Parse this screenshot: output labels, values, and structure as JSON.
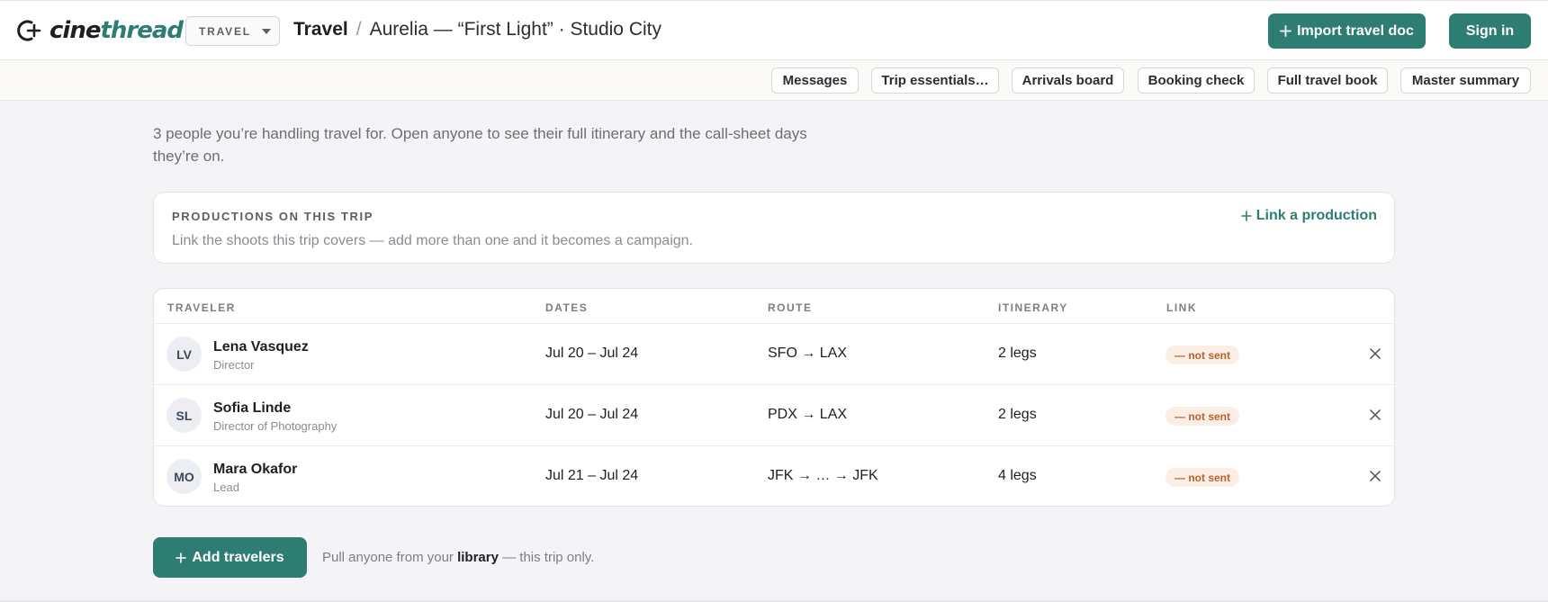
{
  "brand": {
    "logo_text_part1": "cine",
    "logo_text_part2": "thread",
    "accent_color": "#2e7d72"
  },
  "header": {
    "module": "TRAVEL",
    "breadcrumb_root": "Travel",
    "breadcrumb_separator": "/",
    "breadcrumb_current": "Aurelia — “First Light” · Studio City",
    "import_button": "Import travel doc",
    "signin_button": "Sign in"
  },
  "subnav": {
    "items": [
      "Messages",
      "Trip essentials…",
      "Arrivals board",
      "Booking check",
      "Full travel book",
      "Master summary"
    ]
  },
  "intro": "3 people you’re handling travel for. Open anyone to see their full itinerary and the call-sheet days they’re on.",
  "productions": {
    "title": "PRODUCTIONS ON THIS TRIP",
    "description": "Link the shoots this trip covers — add more than one and it becomes a campaign.",
    "link_label": "Link a production"
  },
  "table": {
    "headers": {
      "traveler": "TRAVELER",
      "dates": "DATES",
      "route": "ROUTE",
      "itinerary": "ITINERARY",
      "link": "LINK"
    },
    "rows": [
      {
        "initials": "LV",
        "name": "Lena Vasquez",
        "role": "Director",
        "dates": "Jul 20 – Jul 24",
        "route": "SFO → LAX",
        "itinerary": "2 legs",
        "link_status": "— not sent"
      },
      {
        "initials": "SL",
        "name": "Sofia Linde",
        "role": "Director of Photography",
        "dates": "Jul 20 – Jul 24",
        "route": "PDX → LAX",
        "itinerary": "2 legs",
        "link_status": "— not sent"
      },
      {
        "initials": "MO",
        "name": "Mara Okafor",
        "role": "Lead",
        "dates": "Jul 21 – Jul 24",
        "route": "JFK → … → JFK",
        "itinerary": "4 legs",
        "link_status": "— not sent"
      }
    ]
  },
  "footer": {
    "add_button": "Add travelers",
    "hint_before": "Pull anyone from your ",
    "hint_library": "library",
    "hint_after": " — this trip only."
  }
}
